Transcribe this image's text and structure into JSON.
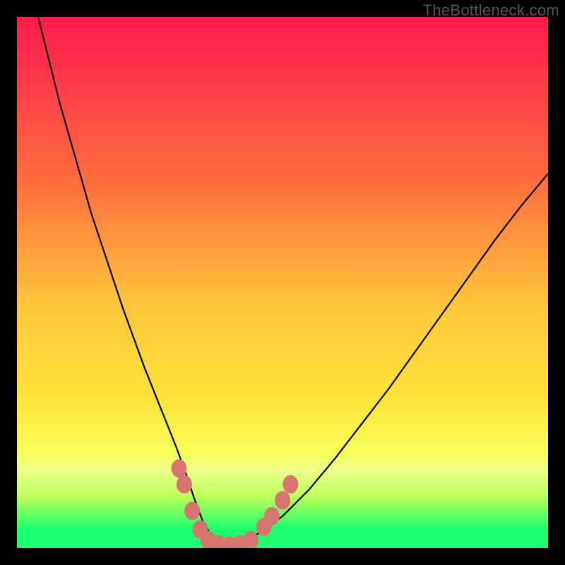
{
  "watermark": "TheBottleneck.com",
  "colors": {
    "frame": "#000000",
    "curve": "#000000",
    "markers": "#d67470",
    "gradient_top": "#ff1a4f",
    "gradient_mid1": "#ff8a3a",
    "gradient_mid2": "#ffe23a",
    "gradient_mid3": "#f6ff5a",
    "gradient_band": "#b8ff5a",
    "gradient_bottom": "#1bff6e"
  },
  "chart_data": {
    "type": "line",
    "title": "",
    "xlabel": "",
    "ylabel": "",
    "xlim": [
      0,
      100
    ],
    "ylim": [
      0,
      100
    ],
    "series": [
      {
        "name": "bottleneck-curve",
        "x": [
          4,
          6,
          8,
          10,
          12,
          14,
          16,
          18,
          20,
          22,
          24,
          26,
          28,
          30,
          32,
          33.5,
          35,
          36.5,
          38,
          40,
          42,
          46,
          50,
          55,
          60,
          65,
          70,
          75,
          80,
          85,
          90,
          95,
          100
        ],
        "y": [
          100,
          92,
          84,
          77,
          70,
          63,
          57,
          51,
          45,
          39.5,
          34,
          29,
          24,
          19,
          13.5,
          9,
          5,
          2.5,
          1,
          0.5,
          1,
          3,
          6,
          11,
          17,
          23.5,
          30,
          37,
          44,
          51,
          58,
          64.5,
          70.5
        ]
      }
    ],
    "markers": [
      {
        "x": 30.5,
        "y": 15
      },
      {
        "x": 31.5,
        "y": 12
      },
      {
        "x": 33.0,
        "y": 7
      },
      {
        "x": 34.5,
        "y": 3.5
      },
      {
        "x": 36.0,
        "y": 1.5
      },
      {
        "x": 38.0,
        "y": 0.7
      },
      {
        "x": 40.0,
        "y": 0.5
      },
      {
        "x": 42.0,
        "y": 0.7
      },
      {
        "x": 44.0,
        "y": 1.5
      },
      {
        "x": 46.5,
        "y": 4
      },
      {
        "x": 48.0,
        "y": 6
      },
      {
        "x": 50.0,
        "y": 9
      },
      {
        "x": 51.5,
        "y": 12
      }
    ],
    "gradient_stops": [
      {
        "pos": 0.0,
        "color": "#ff1a4f"
      },
      {
        "pos": 0.3,
        "color": "#ff6a3f"
      },
      {
        "pos": 0.55,
        "color": "#ffc83a"
      },
      {
        "pos": 0.72,
        "color": "#ffe23a"
      },
      {
        "pos": 0.82,
        "color": "#f6ff5a"
      },
      {
        "pos": 0.85,
        "color": "#f0ff8a"
      },
      {
        "pos": 0.905,
        "color": "#b8ff5a"
      },
      {
        "pos": 0.965,
        "color": "#1bff6e"
      },
      {
        "pos": 1.0,
        "color": "#1bff6e"
      }
    ]
  }
}
